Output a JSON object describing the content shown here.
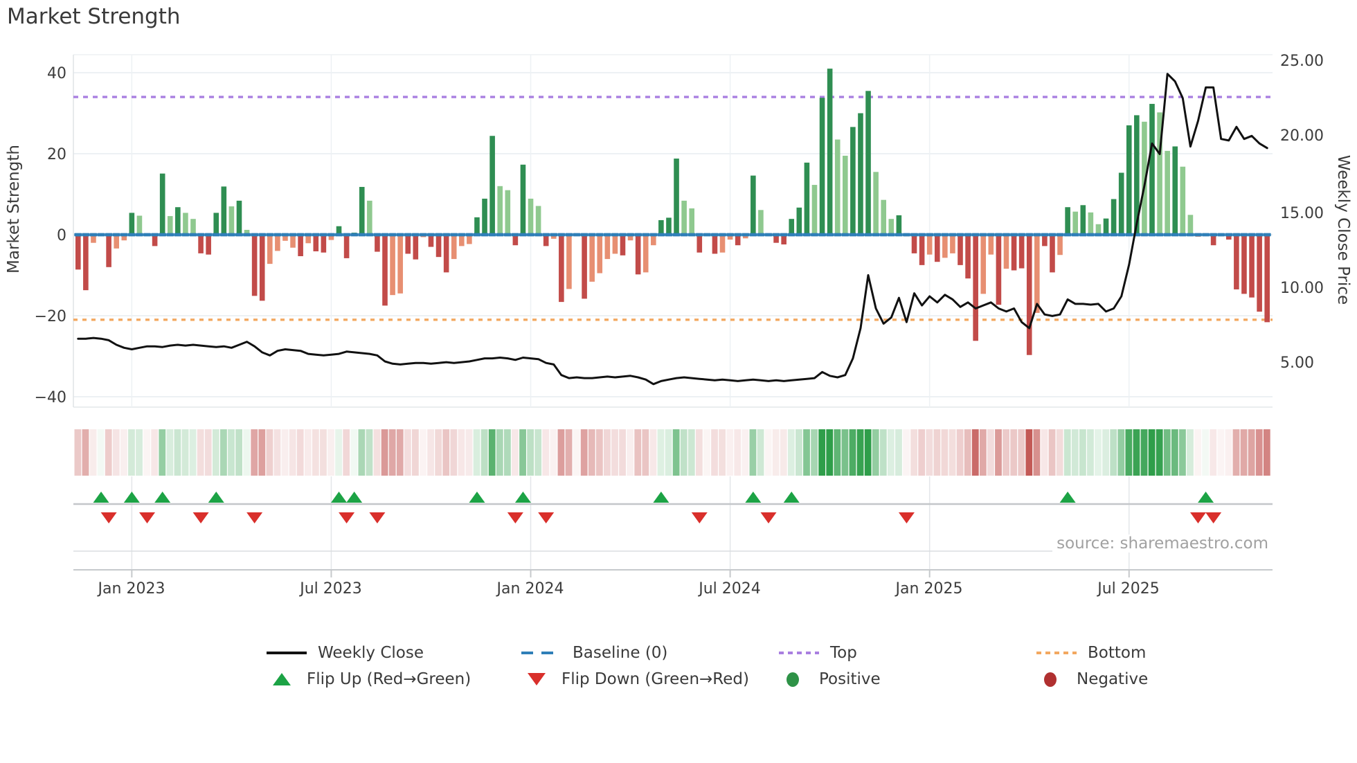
{
  "title": "Market Strength",
  "source": "source: sharemaestro.com",
  "axes": {
    "left": {
      "label": "Market Strength",
      "ticks": [
        "40",
        "20",
        "0",
        "−20",
        "−40"
      ]
    },
    "right": {
      "label": "Weekly Close Price",
      "ticks": [
        "25.00",
        "20.00",
        "15.00",
        "10.00",
        "5.00"
      ]
    },
    "x": {
      "ticks": [
        "Jan 2023",
        "Jul 2023",
        "Jan 2024",
        "Jul 2024",
        "Jan 2025",
        "Jul 2025"
      ]
    }
  },
  "legend": {
    "rows": [
      [
        {
          "icon": "line-swatch",
          "label": "Weekly Close"
        },
        {
          "icon": "dashed-blue-swatch",
          "label": "Baseline (0)"
        },
        {
          "icon": "dotted-purple-swatch",
          "label": "Top"
        },
        {
          "icon": "dotted-orange-swatch",
          "label": "Bottom"
        }
      ],
      [
        {
          "icon": "triangle-up-swatch",
          "label": "Flip Up (Red→Green)"
        },
        {
          "icon": "triangle-down-swatch",
          "label": "Flip Down (Green→Red)"
        },
        {
          "icon": "dot-positive-swatch",
          "label": "Positive"
        },
        {
          "icon": "dot-negative-swatch",
          "label": "Negative"
        }
      ]
    ]
  },
  "colors": {
    "bar_positive_strong": "#2f8e52",
    "bar_positive_soft": "#8fc98f",
    "bar_negative_strong": "#c24b49",
    "bar_negative_soft": "#e78f72",
    "baseline_dash": "#2f7fb8",
    "top_line": "#a97fe0",
    "bottom_line": "#f3a860",
    "price_line": "#111111",
    "flip_up": "#1ca345",
    "flip_down": "#d92f2b",
    "heat_green": "#2f9e4a",
    "heat_red": "#c0504d",
    "grid": "#edf1f4",
    "axis_line": "#c6c9cc"
  },
  "chart_data": {
    "type": "bar+line",
    "title": "Market Strength",
    "x_axis": {
      "unit": "week",
      "tick_labels": [
        "Jan 2023",
        "Jul 2023",
        "Jan 2024",
        "Jul 2024",
        "Jan 2025",
        "Jul 2025"
      ],
      "tick_weeks": [
        7,
        33,
        59,
        85,
        111,
        137
      ]
    },
    "left_axis": {
      "label": "Market Strength",
      "ticks": [
        40,
        20,
        0,
        -20,
        -40
      ],
      "ylim": [
        -44,
        46
      ],
      "ref_top": 34,
      "ref_bottom": -21,
      "baseline": 0
    },
    "right_axis": {
      "label": "Weekly Close Price",
      "ticks": [
        25,
        20,
        15,
        10,
        5
      ]
    },
    "legend_position": "bottom",
    "grid": true,
    "series": {
      "strength_values": [
        -8.6,
        -13.7,
        -2,
        0.3,
        -8,
        -3.4,
        -1.4,
        5.4,
        4.7,
        -0.3,
        -2.8,
        15.1,
        4.6,
        6.8,
        5.4,
        3.9,
        -4.6,
        -4.9,
        5.4,
        11.9,
        7,
        8.4,
        1.2,
        -15.1,
        -16.3,
        -7.2,
        -4,
        -1.5,
        -3.2,
        -5.3,
        -2.1,
        -4.1,
        -4.4,
        -1.3,
        2.1,
        -5.8,
        0.5,
        11.8,
        8.4,
        -4.2,
        -17.5,
        -14.9,
        -14.5,
        -4.7,
        -6.1,
        -0.6,
        -3,
        -5.5,
        -9.3,
        -6,
        -2.8,
        -2.3,
        4.3,
        8.9,
        24.4,
        12,
        11,
        -2.6,
        17.3,
        8.9,
        7.1,
        -2.8,
        -1,
        -16.6,
        -13.4,
        -0.3,
        -15.8,
        -11.6,
        -9.5,
        -6,
        -4.7,
        -5.1,
        -1.4,
        -9.8,
        -9.3,
        -2.6,
        3.6,
        4.2,
        18.8,
        8.4,
        6.5,
        -4.4,
        -0.3,
        -4.7,
        -4.4,
        -1.2,
        -2.6,
        -0.9,
        14.6,
        6.1,
        -0.3,
        -2,
        -2.4,
        3.9,
        6.7,
        17.8,
        12.3,
        33.8,
        41,
        23.5,
        19.5,
        26.6,
        30,
        35.5,
        15.5,
        8.6,
        3.9,
        4.8,
        -0.4,
        -4.6,
        -7.5,
        -4.9,
        -6.7,
        -5.7,
        -4.6,
        -7.5,
        -10.8,
        -26.2,
        -14.6,
        -4.9,
        -17.3,
        -8.4,
        -8.8,
        -8.3,
        -29.7,
        -19.3,
        -2.8,
        -9.3,
        -5,
        6.8,
        5.7,
        7.3,
        5.5,
        2.6,
        4,
        8.8,
        15.3,
        27,
        29.5,
        27.9,
        32.3,
        30.2,
        20.7,
        21.8,
        16.8,
        4.9,
        -0.5,
        0.3,
        -2.6,
        -0.4,
        -1.2,
        -13.5,
        -14.6,
        -15.5,
        -19,
        -21.6
      ],
      "strength_shades": "DDsgDssGgsDGgGggDDGGgGgDDssssDsDDsGDGGgDDssDDsDDDsssGGGggDGggDsDssDssssDsDssGGGggDsDssDsGgsDDGGGgGGggGGGgggGsDDsDssDDDssDsDDDsDDsGgGggGGGGGgGggGggsgDsDDDDDD",
      "weekly_close": [
        6.6,
        6.6,
        6.65,
        6.6,
        6.5,
        6.2,
        6,
        5.9,
        6,
        6.1,
        6.1,
        6.05,
        6.15,
        6.2,
        6.15,
        6.2,
        6.15,
        6.1,
        6.05,
        6.1,
        6,
        6.2,
        6.4,
        6.1,
        5.7,
        5.5,
        5.8,
        5.9,
        5.85,
        5.8,
        5.6,
        5.55,
        5.5,
        5.55,
        5.6,
        5.75,
        5.7,
        5.65,
        5.6,
        5.5,
        5.1,
        4.95,
        4.9,
        4.95,
        5,
        5,
        4.95,
        5,
        5.05,
        5,
        5.05,
        5.1,
        5.2,
        5.3,
        5.3,
        5.35,
        5.3,
        5.2,
        5.35,
        5.3,
        5.25,
        5,
        4.9,
        4.2,
        4,
        4.05,
        4,
        4,
        4.05,
        4.1,
        4.05,
        4.1,
        4.15,
        4.05,
        3.9,
        3.6,
        3.8,
        3.9,
        4,
        4.05,
        4,
        3.95,
        3.9,
        3.85,
        3.9,
        3.85,
        3.8,
        3.85,
        3.9,
        3.85,
        3.8,
        3.85,
        3.8,
        3.85,
        3.9,
        3.95,
        4,
        4.4,
        4.15,
        4.05,
        4.2,
        5.3,
        7.3,
        10.8,
        8.6,
        7.6,
        8,
        9.3,
        7.7,
        9.6,
        8.8,
        9.4,
        9,
        9.5,
        9.2,
        8.7,
        9,
        8.6,
        8.8,
        9,
        8.6,
        8.4,
        8.6,
        7.7,
        7.3,
        8.9,
        8.2,
        8.1,
        8.2,
        9.2,
        8.9,
        8.9,
        8.85,
        8.9,
        8.4,
        8.6,
        9.4,
        11.5,
        14.2,
        16.7,
        19.5,
        18.8,
        24.1,
        23.6,
        22.5,
        19.3,
        21,
        23.2,
        23.2,
        19.8,
        19.7,
        20.6,
        19.8,
        20,
        19.5,
        19.2
      ],
      "flip_up_weeks": [
        3,
        7,
        11,
        18,
        34,
        36,
        52,
        58,
        76,
        88,
        93,
        129,
        147
      ],
      "flip_down_weeks": [
        4,
        9,
        16,
        23,
        35,
        39,
        57,
        61,
        81,
        90,
        108,
        146,
        148
      ]
    }
  }
}
